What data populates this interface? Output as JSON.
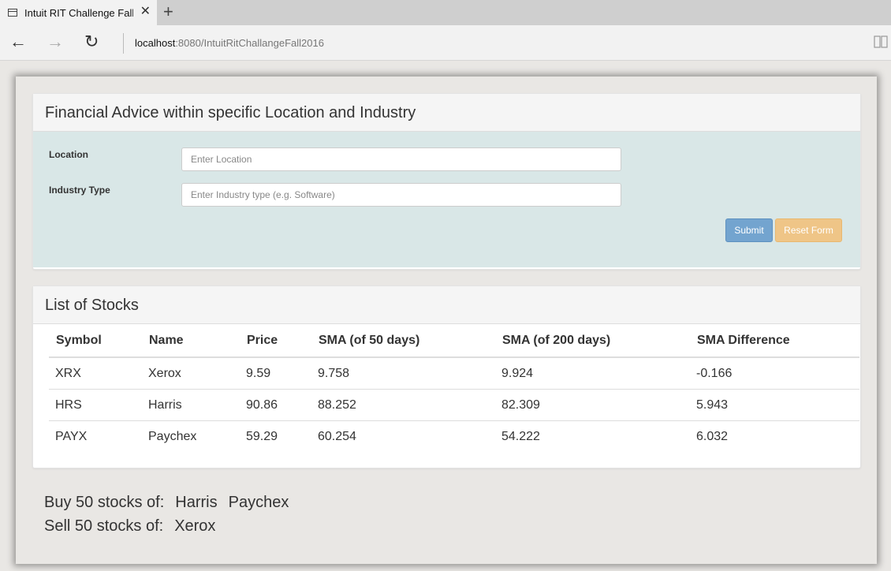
{
  "browser": {
    "tab_title": "Intuit RIT Challenge Fall'",
    "url_host": "localhost",
    "url_rest": ":8080/IntuitRitChallangeFall2016"
  },
  "form": {
    "title": "Financial Advice within specific Location and Industry",
    "location_label": "Location",
    "location_placeholder": "Enter Location",
    "location_value": "",
    "industry_label": "Industry Type",
    "industry_placeholder": "Enter Industry type (e.g. Software)",
    "industry_value": "",
    "submit_label": "Submit",
    "reset_label": "Reset Form"
  },
  "stocks": {
    "title": "List of Stocks",
    "columns": [
      "Symbol",
      "Name",
      "Price",
      "SMA (of 50 days)",
      "SMA (of 200 days)",
      "SMA Difference"
    ],
    "rows": [
      [
        "XRX",
        "Xerox",
        "9.59",
        "9.758",
        "9.924",
        "-0.166"
      ],
      [
        "HRS",
        "Harris",
        "90.86",
        "88.252",
        "82.309",
        "5.943"
      ],
      [
        "PAYX",
        "Paychex",
        "59.29",
        "60.254",
        "54.222",
        "6.032"
      ]
    ]
  },
  "advice": {
    "buy_label": "Buy 50 stocks of:",
    "buy_items": [
      "Harris",
      "Paychex"
    ],
    "sell_label": "Sell 50 stocks of:",
    "sell_items": [
      "Xerox"
    ]
  },
  "colors": {
    "submit": "#73a4cf",
    "reset": "#efc587",
    "form_bg": "#d9e7e7"
  }
}
